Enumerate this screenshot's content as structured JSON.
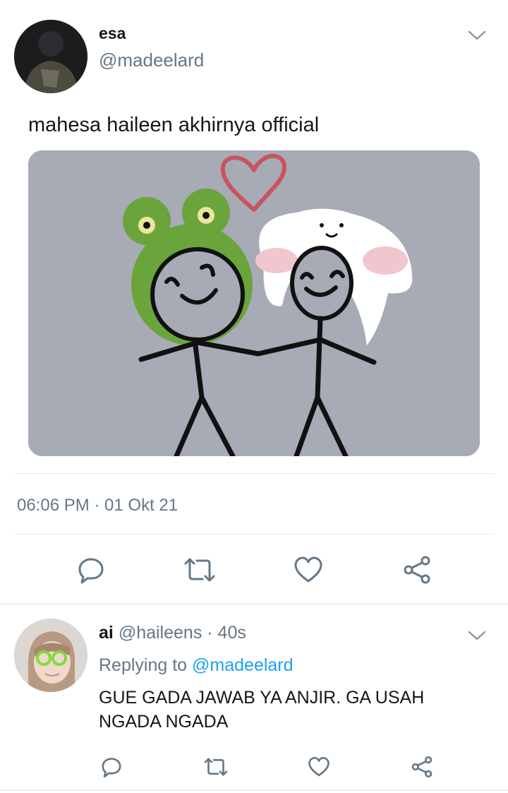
{
  "tweet": {
    "display_name": "esa",
    "handle": "@madeelard",
    "text": "mahesa haileen akhirnya official",
    "timestamp": "06:06 PM · 01 Okt 21",
    "menu_icon": "chevron-down-icon",
    "actions": [
      "reply-icon",
      "retweet-icon",
      "like-icon",
      "share-icon"
    ]
  },
  "reply": {
    "display_name": "ai",
    "handle": "@haileens",
    "time": "· 40s",
    "replying_prefix": "Replying to",
    "replying_handle": "@madeelard",
    "text_line1": "GUE GADA JAWAB YA ANJIR. GA USAH",
    "text_line2": "NGADA NGADA",
    "menu_icon": "chevron-down-icon",
    "actions": [
      "reply-icon",
      "retweet-icon",
      "like-icon",
      "share-icon"
    ]
  },
  "colors": {
    "accent": "#1da1f2",
    "secondary_text": "#657786",
    "divider": "#e1e8ed",
    "image_bg": "#a7acb5"
  }
}
